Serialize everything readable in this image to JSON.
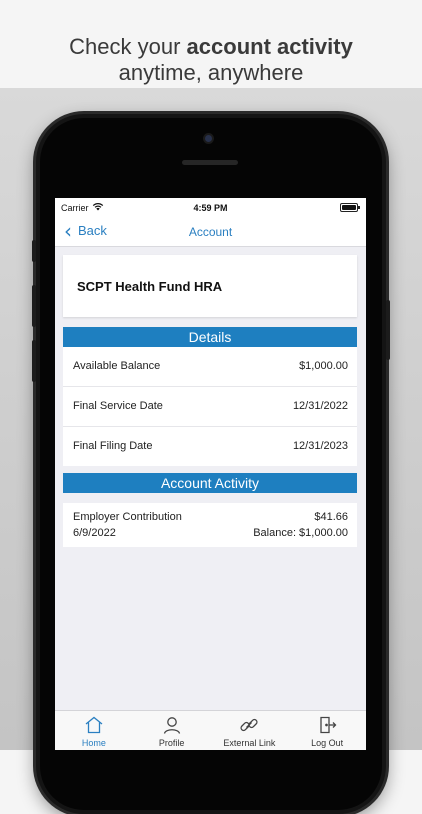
{
  "headline": {
    "line1_prefix": "Check your ",
    "line1_bold": "account activity",
    "line2": "anytime, anywhere"
  },
  "status_bar": {
    "carrier": "Carrier",
    "time": "4:59 PM"
  },
  "nav": {
    "back_label": "Back",
    "title": "Account"
  },
  "account": {
    "name": "SCPT Health Fund HRA"
  },
  "details": {
    "header": "Details",
    "rows": [
      {
        "label": "Available Balance",
        "value": "$1,000.00"
      },
      {
        "label": "Final Service Date",
        "value": "12/31/2022"
      },
      {
        "label": "Final Filing Date",
        "value": "12/31/2023"
      }
    ]
  },
  "activity": {
    "header": "Account Activity",
    "items": [
      {
        "description": "Employer Contribution",
        "amount": "$41.66",
        "date": "6/9/2022",
        "balance": "Balance: $1,000.00"
      }
    ]
  },
  "tabbar": {
    "items": [
      {
        "label": "Home",
        "icon": "home-icon",
        "active": true
      },
      {
        "label": "Profile",
        "icon": "profile-icon",
        "active": false
      },
      {
        "label": "External Link",
        "icon": "link-icon",
        "active": false
      },
      {
        "label": "Log Out",
        "icon": "logout-icon",
        "active": false
      }
    ]
  },
  "colors": {
    "accent": "#1e7fc0",
    "link": "#2a7fc1",
    "screen_bg": "#efeff4"
  }
}
